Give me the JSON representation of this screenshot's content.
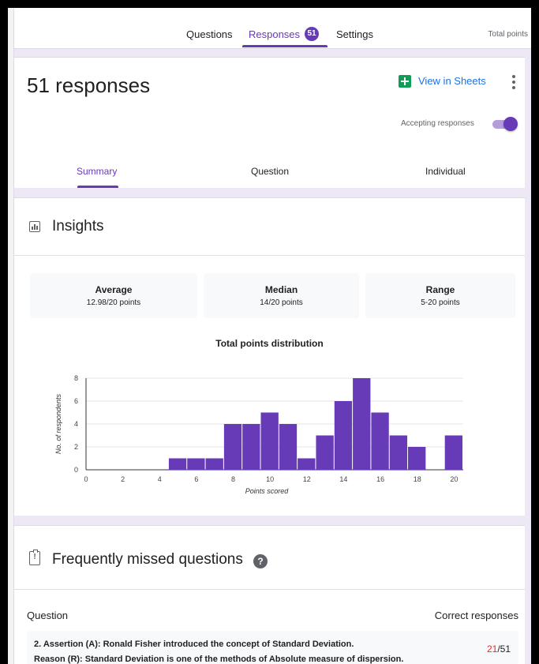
{
  "nav": {
    "tabs": [
      {
        "label": "Questions",
        "active": false
      },
      {
        "label": "Responses",
        "active": true
      },
      {
        "label": "Settings",
        "active": false
      }
    ],
    "responses_badge": "51",
    "total_points_label": "Total points"
  },
  "header": {
    "title": "51 responses",
    "view_in_sheets": "View in Sheets",
    "accepting_label": "Accepting responses",
    "accepting_on": true,
    "subtabs": [
      {
        "label": "Summary",
        "active": true
      },
      {
        "label": "Question",
        "active": false
      },
      {
        "label": "Individual",
        "active": false
      }
    ]
  },
  "insights": {
    "title": "Insights",
    "stats": [
      {
        "label": "Average",
        "value": "12.98/20 points"
      },
      {
        "label": "Median",
        "value": "14/20 points"
      },
      {
        "label": "Range",
        "value": "5-20 points"
      }
    ]
  },
  "chart_data": {
    "type": "bar",
    "title": "Total points distribution",
    "xlabel": "Points scored",
    "ylabel": "No. of respondents",
    "x": [
      5,
      6,
      7,
      8,
      9,
      10,
      11,
      12,
      13,
      14,
      15,
      16,
      17,
      18,
      20
    ],
    "values": [
      1,
      1,
      1,
      4,
      4,
      5,
      4,
      1,
      3,
      6,
      8,
      5,
      3,
      2,
      3
    ],
    "xlim": [
      0,
      20.5
    ],
    "ylim": [
      0,
      8
    ],
    "xticks": [
      "0",
      "2",
      "4",
      "6",
      "8",
      "10",
      "12",
      "14",
      "16",
      "18",
      "20"
    ],
    "yticks": [
      "0",
      "2",
      "4",
      "6",
      "8"
    ],
    "grid": true,
    "color": "#673ab7"
  },
  "missed": {
    "title": "Frequently missed questions",
    "col_question": "Question",
    "col_correct": "Correct responses",
    "rows": [
      {
        "line1": "2.  Assertion (A): Ronald Fisher introduced the concept of Standard Deviation.",
        "line2": "Reason (R): Standard Deviation is one of the methods of Absolute measure of dispersion.",
        "correct": "21",
        "total": "/51"
      }
    ]
  },
  "colors": {
    "accent": "#673ab7",
    "link": "#1a73e8",
    "sheets": "#0f9d58",
    "error": "#d93025"
  }
}
